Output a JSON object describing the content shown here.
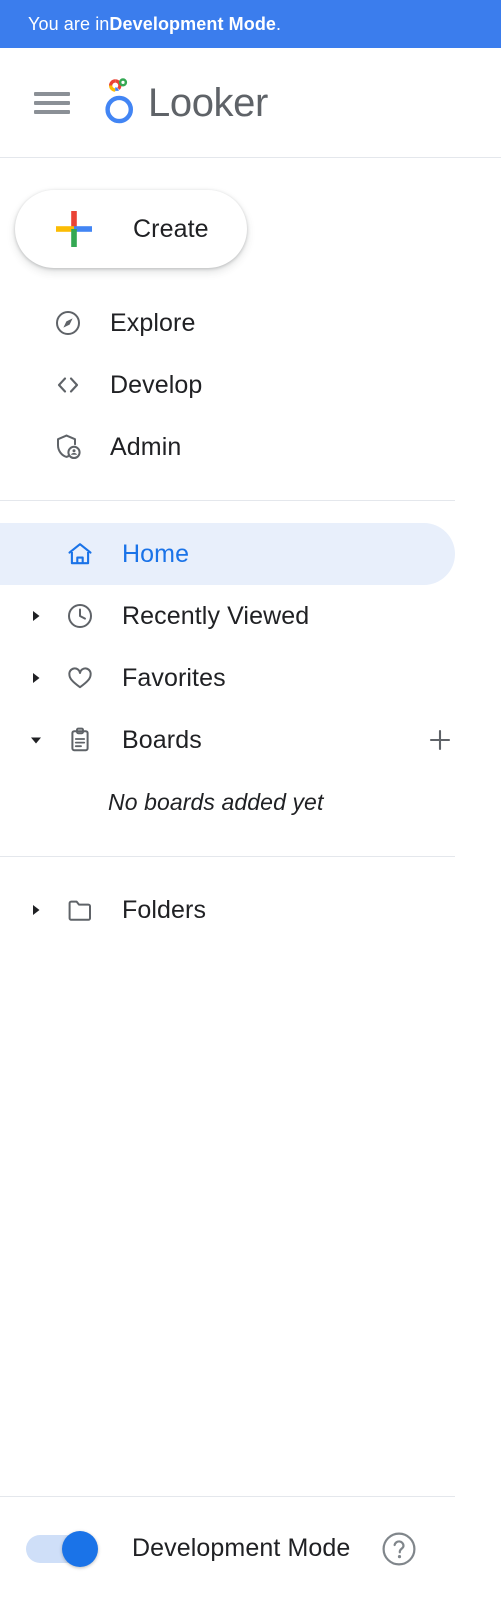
{
  "banner": {
    "prefix": "You are in ",
    "emphasis": "Development Mode",
    "suffix": ".",
    "background_color": "#3b7ded",
    "text_color": "#ffffff"
  },
  "header": {
    "menu_icon": "hamburger-icon",
    "logo_icon": "looker-logo-icon",
    "brand_name": "Looker"
  },
  "create": {
    "label": "Create",
    "icon": "google-plus-icon"
  },
  "primary_nav": {
    "items": [
      {
        "label": "Explore",
        "icon": "compass-icon"
      },
      {
        "label": "Develop",
        "icon": "code-brackets-icon"
      },
      {
        "label": "Admin",
        "icon": "shield-person-icon"
      }
    ]
  },
  "browse_nav": {
    "items": [
      {
        "label": "Home",
        "icon": "home-icon",
        "selected": true,
        "twisty": "none"
      },
      {
        "label": "Recently Viewed",
        "icon": "clock-icon",
        "selected": false,
        "twisty": "collapsed"
      },
      {
        "label": "Favorites",
        "icon": "heart-icon",
        "selected": false,
        "twisty": "collapsed"
      },
      {
        "label": "Boards",
        "icon": "clipboard-icon",
        "selected": false,
        "twisty": "expanded",
        "trailing_icon": "plus-icon"
      }
    ],
    "boards_empty_text": "No boards added yet"
  },
  "folders_nav": {
    "items": [
      {
        "label": "Folders",
        "icon": "folder-icon",
        "twisty": "collapsed"
      }
    ]
  },
  "footer": {
    "toggle_label": "Development Mode",
    "toggle_on": true,
    "help_icon": "help-circle-icon"
  },
  "colors": {
    "accent_blue": "#1a73e8",
    "banner_blue": "#3b7ded",
    "selected_pill": "#e8effb",
    "icon_gray": "#5f6368",
    "text_primary": "#202124",
    "divider": "#e4e7ec",
    "google_red": "#ea4335",
    "google_yellow": "#fbbc04",
    "google_green": "#34a853",
    "google_blue": "#4285f4"
  }
}
